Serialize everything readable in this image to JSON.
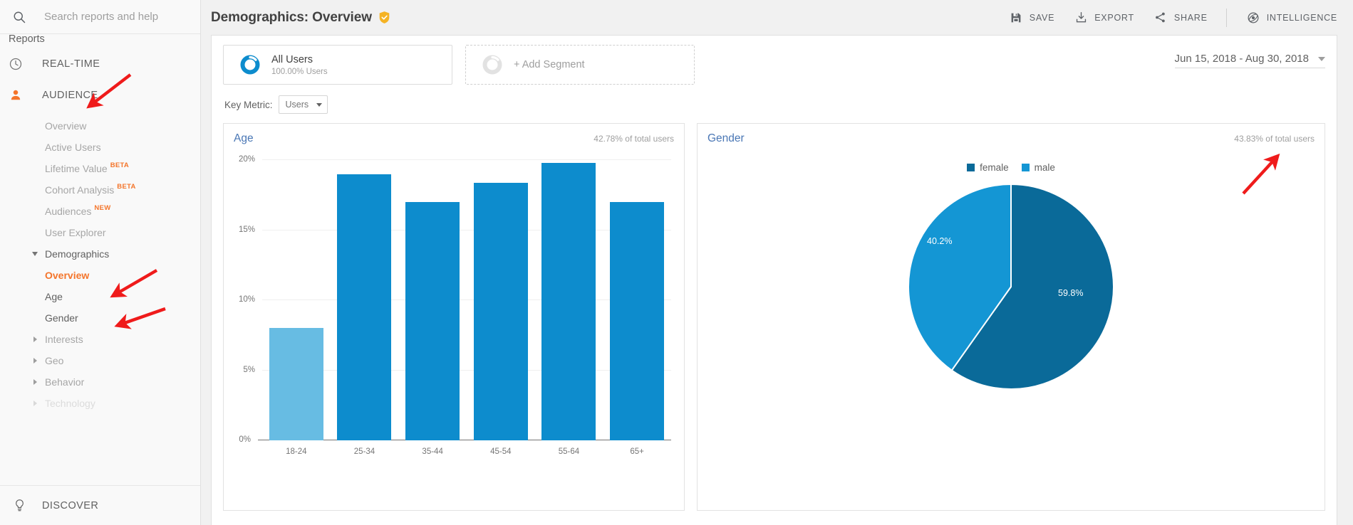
{
  "sidebar": {
    "search": {
      "placeholder": "Search reports and help"
    },
    "reports_label": "Reports",
    "top_items": [
      {
        "label": "REAL-TIME",
        "icon": "clock-icon"
      },
      {
        "label": "AUDIENCE",
        "icon": "person-icon"
      }
    ],
    "audience_items": [
      {
        "label": "Overview",
        "badge": "",
        "state": "dim"
      },
      {
        "label": "Active Users",
        "badge": "",
        "state": "dim"
      },
      {
        "label": "Lifetime Value",
        "badge": "BETA",
        "state": "dim"
      },
      {
        "label": "Cohort Analysis",
        "badge": "BETA",
        "state": "dim"
      },
      {
        "label": "Audiences",
        "badge": "NEW",
        "state": "dim"
      },
      {
        "label": "User Explorer",
        "badge": "",
        "state": "dim"
      },
      {
        "label": "Demographics",
        "badge": "",
        "state": "strong",
        "caret": "open"
      },
      {
        "label": "Overview",
        "badge": "",
        "state": "selected"
      },
      {
        "label": "Age",
        "badge": "",
        "state": "strong"
      },
      {
        "label": "Gender",
        "badge": "",
        "state": "strong"
      },
      {
        "label": "Interests",
        "badge": "",
        "state": "dim",
        "caret": "closed"
      },
      {
        "label": "Geo",
        "badge": "",
        "state": "dim",
        "caret": "closed"
      },
      {
        "label": "Behavior",
        "badge": "",
        "state": "dim",
        "caret": "closed"
      },
      {
        "label": "Technology",
        "badge": "",
        "state": "dim",
        "caret": "closed"
      }
    ],
    "discover": {
      "label": "DISCOVER",
      "icon": "lightbulb-icon"
    }
  },
  "header": {
    "title": "Demographics: Overview",
    "shield_icon": "shield-check-icon",
    "actions": [
      {
        "label": "SAVE",
        "icon": "save-icon"
      },
      {
        "label": "EXPORT",
        "icon": "export-icon"
      },
      {
        "label": "SHARE",
        "icon": "share-icon"
      },
      {
        "label": "INTELLIGENCE",
        "icon": "intelligence-icon"
      }
    ]
  },
  "segments": {
    "all_users": {
      "name": "All Users",
      "sub": "100.00% Users"
    },
    "add_segment": {
      "label": "+ Add Segment"
    }
  },
  "date_range": {
    "value": "Jun 15, 2018 - Aug 30, 2018"
  },
  "key_metric": {
    "label": "Key Metric:",
    "value": "Users"
  },
  "panels": {
    "age": {
      "title": "Age",
      "total": "42.78% of total users"
    },
    "gender": {
      "title": "Gender",
      "total": "43.83% of total users"
    }
  },
  "colors": {
    "bar": "#0d8ccd",
    "bar_highlight": "#67bce3",
    "pie_female": "#0a6a99",
    "pie_male": "#1496d4",
    "accent_orange": "#f4752b",
    "link_blue": "#4a77b5",
    "shield_gold": "#f5b324",
    "arrow_red": "#ef1b1b"
  },
  "chart_data": [
    {
      "type": "bar",
      "title": "Age",
      "categories": [
        "18-24",
        "25-34",
        "35-44",
        "45-54",
        "55-64",
        "65+"
      ],
      "values": [
        8.0,
        19.0,
        17.0,
        18.4,
        19.8,
        17.0
      ],
      "highlight_index": 0,
      "xlabel": "",
      "ylabel": "",
      "ylim": [
        0,
        20
      ],
      "yticks": [
        0,
        5,
        10,
        15,
        20
      ],
      "ytick_labels": [
        "0%",
        "5%",
        "10%",
        "15%",
        "20%"
      ],
      "grid": true,
      "legend": "none",
      "annotation": "42.78% of total users"
    },
    {
      "type": "pie",
      "title": "Gender",
      "labels": [
        "female",
        "male"
      ],
      "values": [
        59.8,
        40.2
      ],
      "value_labels": [
        "59.8%",
        "40.2%"
      ],
      "colors": [
        "#0a6a99",
        "#1496d4"
      ],
      "legend": "top",
      "annotation": "43.83% of total users"
    }
  ]
}
